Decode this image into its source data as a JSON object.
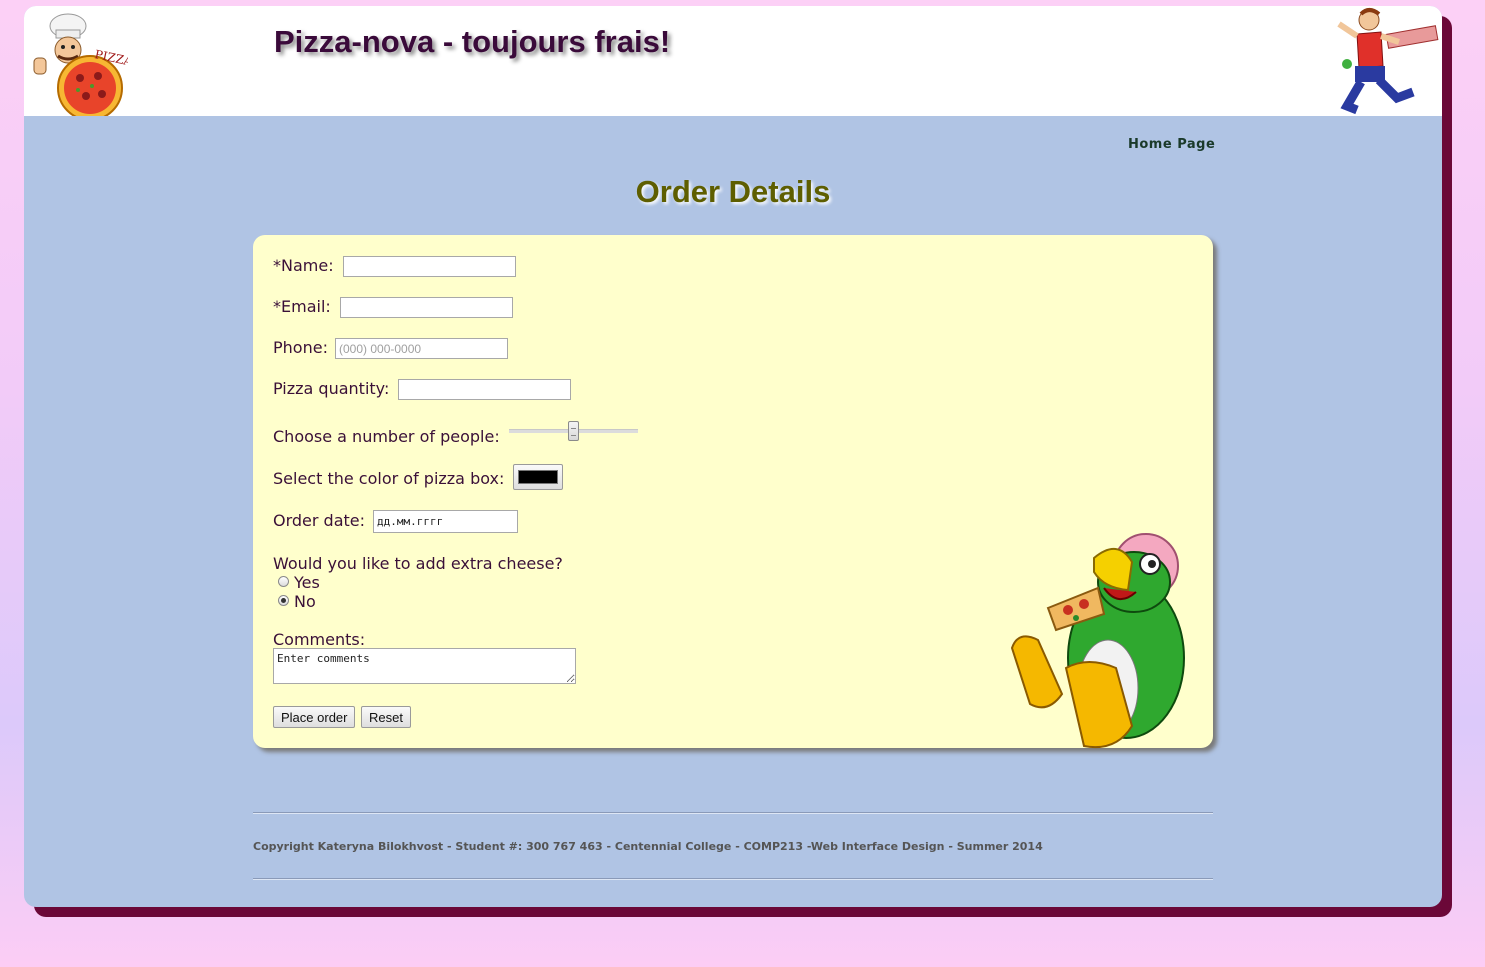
{
  "header": {
    "site_title": "Pizza-nova - toujours frais!",
    "logo_left_icon": "chef-pizza-logo-icon",
    "logo_right_icon": "pizza-delivery-runner-icon"
  },
  "nav": {
    "home_link": "Home Page"
  },
  "page": {
    "title": "Order Details"
  },
  "form": {
    "name_label": "*Name:",
    "name_value": "",
    "email_label": "*Email:",
    "email_value": "",
    "phone_label": "Phone:",
    "phone_placeholder": "(000) 000-0000",
    "quantity_label": "Pizza quantity:",
    "quantity_value": "",
    "people_label": "Choose a number of people:",
    "people_slider_level": 0.5,
    "box_color_label": "Select the color of pizza box:",
    "box_color_value": "#000000",
    "order_date_label": "Order date:",
    "order_date_value": "дд.мм.гггг",
    "cheese_question": "Would you like to add extra cheese?",
    "cheese_options": [
      {
        "label": "Yes",
        "checked": false
      },
      {
        "label": "No",
        "checked": true
      }
    ],
    "comments_label": "Comments:",
    "comments_value": "Enter comments",
    "place_order_button": "Place order",
    "reset_button": "Reset",
    "decoration_icon": "penguin-eating-pizza-icon"
  },
  "footer": {
    "copyright": "Copyright Kateryna Bilokhvost - Student #: 300 767 463 - Centennial College - COMP213 -Web Interface Design - Summer 2014"
  },
  "colors": {
    "page_background": "#fcd0f6",
    "container_background": "#b0c4e4",
    "container_shadow": "#6b0838",
    "form_background": "#ffffcc",
    "title_color": "#5e5e00",
    "site_title_color": "#3a0a3a"
  }
}
